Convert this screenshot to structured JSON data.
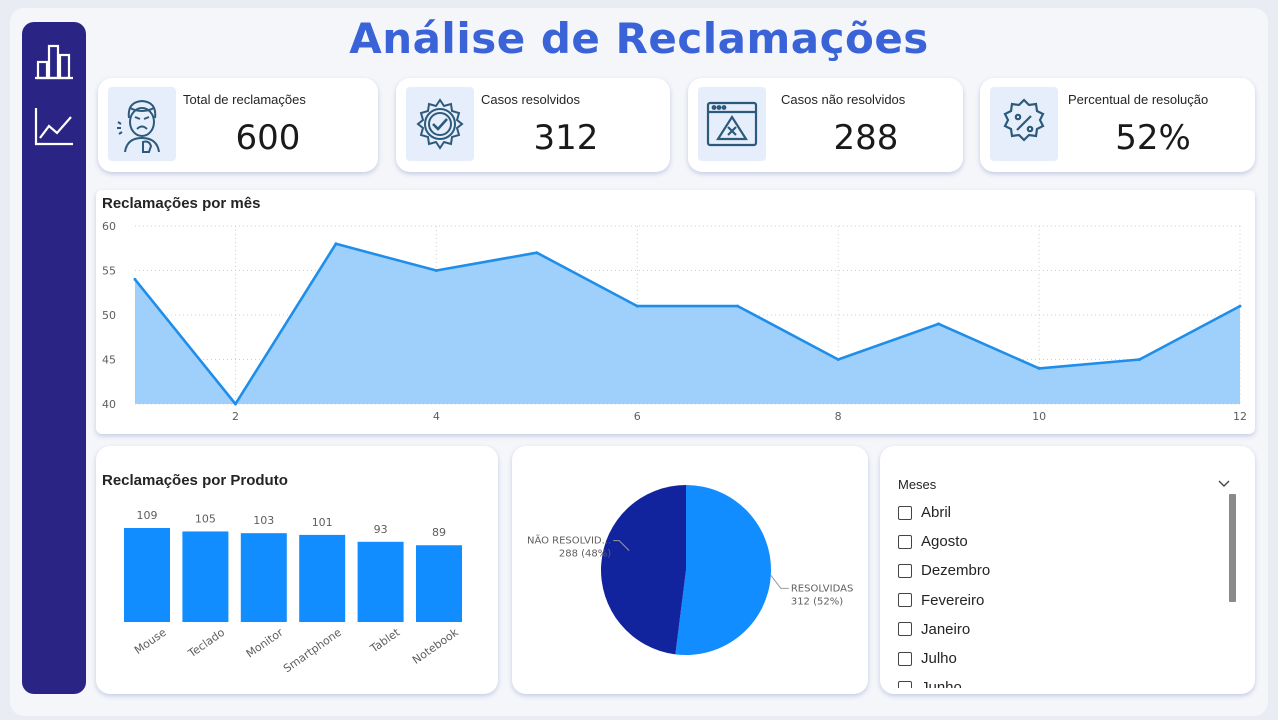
{
  "header": {
    "title": "Análise de Reclamações"
  },
  "sidebar": {
    "items": [
      {
        "icon": "bar-chart-icon"
      },
      {
        "icon": "line-chart-icon"
      }
    ]
  },
  "kpis": [
    {
      "label": "Total de reclamações",
      "value": "600",
      "icon": "angry-person-icon"
    },
    {
      "label": "Casos resolvidos",
      "value": "312",
      "icon": "check-gear-icon"
    },
    {
      "label": "Casos não resolvidos",
      "value": "288",
      "icon": "error-window-icon"
    },
    {
      "label": "Percentual de resolução",
      "value": "52%",
      "icon": "percent-badge-icon"
    }
  ],
  "colors": {
    "sidebar": "#2a2584",
    "title": "#3a63d8",
    "area_fill": "#9fd0fb",
    "area_line": "#1f8eea",
    "bars": "#118dff",
    "pie_resolved": "#118dff",
    "pie_unresolved": "#12239e"
  },
  "line_chart": {
    "title": "Reclamações por mês",
    "chart_data": {
      "type": "area",
      "x": [
        1,
        2,
        3,
        4,
        5,
        6,
        7,
        8,
        9,
        10,
        11,
        12
      ],
      "y": [
        54,
        40,
        58,
        55,
        57,
        51,
        51,
        45,
        49,
        44,
        45,
        51
      ],
      "xticks": [
        "2",
        "4",
        "6",
        "8",
        "10",
        "12"
      ],
      "yticks": [
        "40",
        "45",
        "50",
        "55",
        "60"
      ],
      "xlim": [
        1,
        12
      ],
      "ylim": [
        40,
        60
      ],
      "grid": true
    }
  },
  "bar_chart": {
    "title": "Reclamações por Produto",
    "chart_data": {
      "type": "bar",
      "categories": [
        "Mouse",
        "Teclado",
        "Monitor",
        "Smartphone",
        "Tablet",
        "Notebook"
      ],
      "values": [
        109,
        105,
        103,
        101,
        93,
        89
      ],
      "data_labels": [
        "109",
        "105",
        "103",
        "101",
        "93",
        "89"
      ]
    }
  },
  "pie_chart": {
    "chart_data": {
      "type": "pie",
      "slices": [
        {
          "label": "RESOLVIDAS",
          "value": 312,
          "detail": "312 (52%)"
        },
        {
          "label": "NÃO RESOLVID...",
          "value": 288,
          "detail": "288 (48%)"
        }
      ]
    }
  },
  "slicer": {
    "title": "Meses",
    "items": [
      "Abril",
      "Agosto",
      "Dezembro",
      "Fevereiro",
      "Janeiro",
      "Julho",
      "Junho"
    ]
  }
}
